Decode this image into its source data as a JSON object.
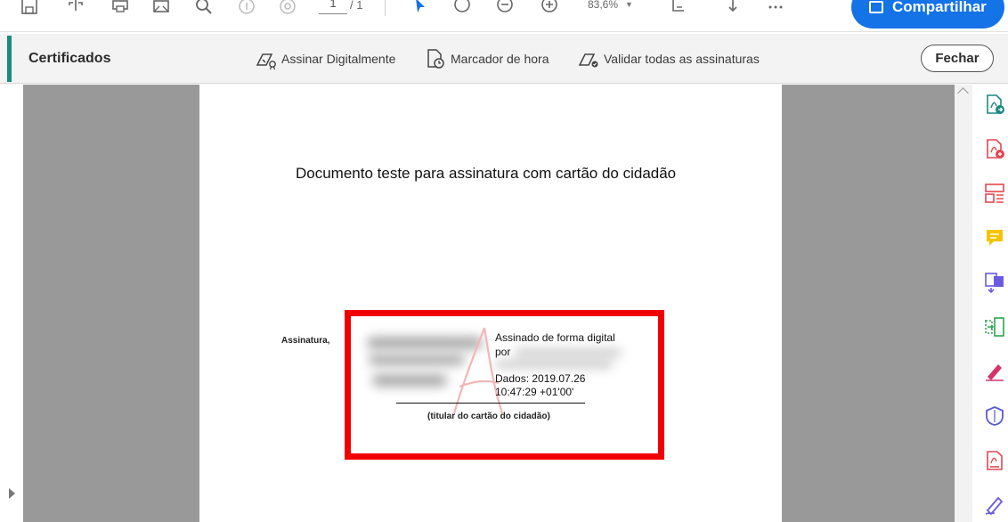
{
  "toolbar": {
    "page_current": "1",
    "page_total": "/ 1",
    "zoom": "83,6%",
    "share_label": "Compartilhar",
    "icons": [
      "save-icon",
      "upload-icon",
      "print-icon",
      "email-icon",
      "search-icon",
      "page-up-icon",
      "page-down-icon",
      "select-icon",
      "hand-icon",
      "zoom-out-icon",
      "zoom-in-icon",
      "fit-page-icon",
      "download-icon",
      "more-icon"
    ]
  },
  "cert_bar": {
    "title": "Certificados",
    "sign_label": "Assinar Digitalmente",
    "timestamp_label": "Marcador de hora",
    "validate_label": "Validar todas as assinaturas",
    "close_label": "Fechar"
  },
  "document": {
    "title": "Documento teste para assinatura com cartão do cidadão",
    "signature_label": "Assinatura,",
    "signed_lines": [
      "Assinado de forma digital",
      "por",
      "Dados: 2019.07.26",
      "10:47:29 +01'00'"
    ],
    "holder_caption": "(titular do cartão do cidadão)"
  },
  "tools": [
    "export-pdf-icon",
    "create-pdf-icon",
    "organize-pages-icon",
    "comment-icon",
    "scan-icon",
    "compress-icon",
    "fill-sign-icon",
    "protect-icon",
    "pdf-file-icon",
    "sign-icon"
  ],
  "colors": {
    "accent": "#1b8a82",
    "share": "#1473e6",
    "highlight": "#f00000",
    "canvas": "#999999"
  }
}
